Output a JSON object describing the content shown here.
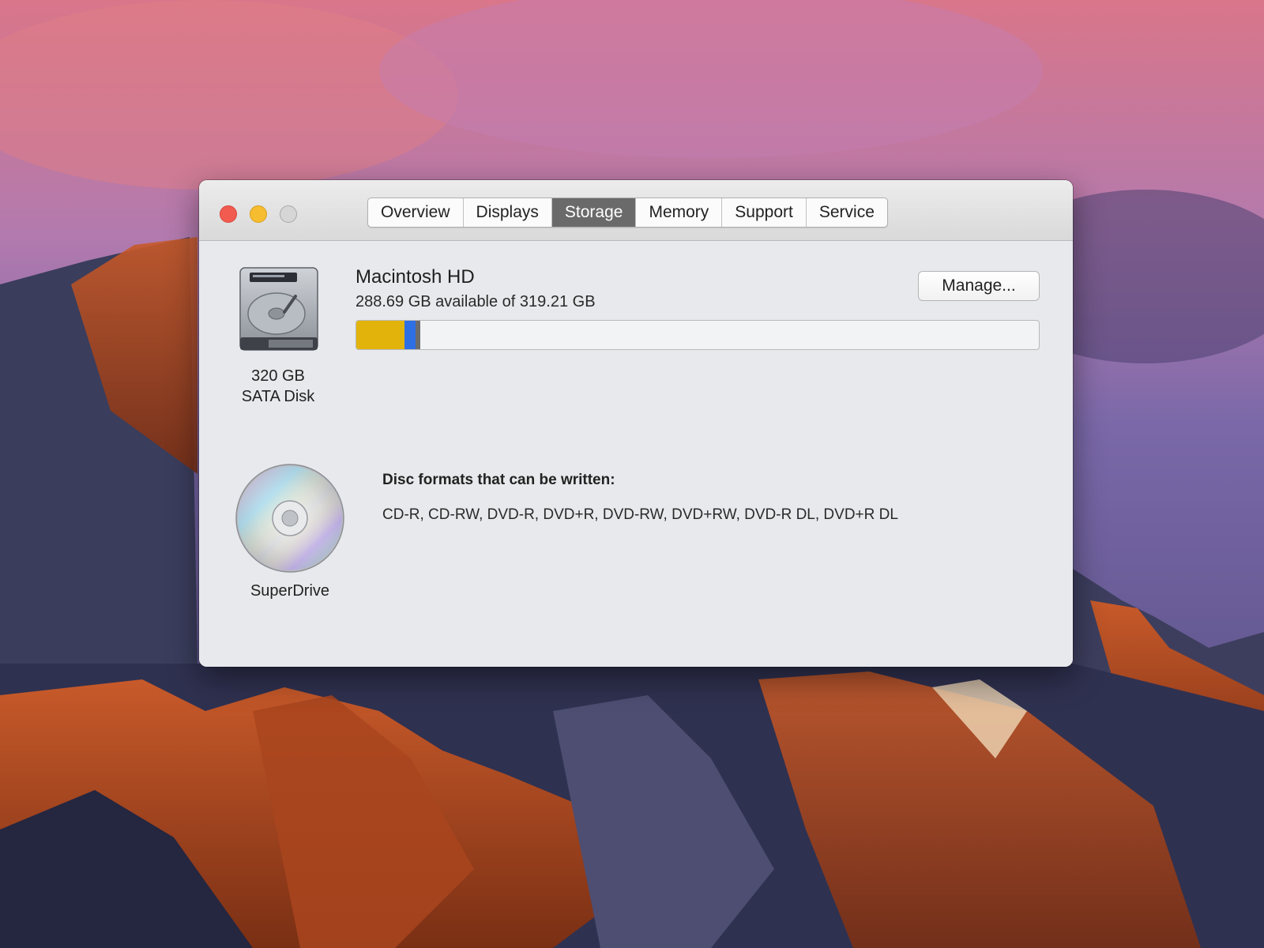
{
  "window": {
    "tabs": [
      {
        "label": "Overview",
        "active": false
      },
      {
        "label": "Displays",
        "active": false
      },
      {
        "label": "Storage",
        "active": true
      },
      {
        "label": "Memory",
        "active": false
      },
      {
        "label": "Support",
        "active": false
      },
      {
        "label": "Service",
        "active": false
      }
    ],
    "traffic_lights": {
      "close": "#f25b50",
      "minimize": "#f5bd2f",
      "zoom": "#d6d6d6"
    }
  },
  "storage": {
    "disk": {
      "icon": "hard-drive-icon",
      "capacity": "320 GB",
      "type": "SATA Disk"
    },
    "volume": {
      "name": "Macintosh HD",
      "available_text": "288.69 GB available of 319.21 GB",
      "manage_label": "Manage...",
      "usage_segments": [
        {
          "fraction": 0.0704,
          "color": "#e2b40b"
        },
        {
          "fraction": 0.0164,
          "color": "#2f6fe4"
        },
        {
          "fraction": 0.007,
          "color": "#6b6b6b"
        }
      ]
    }
  },
  "optical": {
    "icon": "optical-disc-icon",
    "name": "SuperDrive",
    "heading": "Disc formats that can be written:",
    "formats": "CD-R, CD-RW, DVD-R, DVD+R, DVD-RW, DVD+RW, DVD-R DL, DVD+R DL"
  }
}
